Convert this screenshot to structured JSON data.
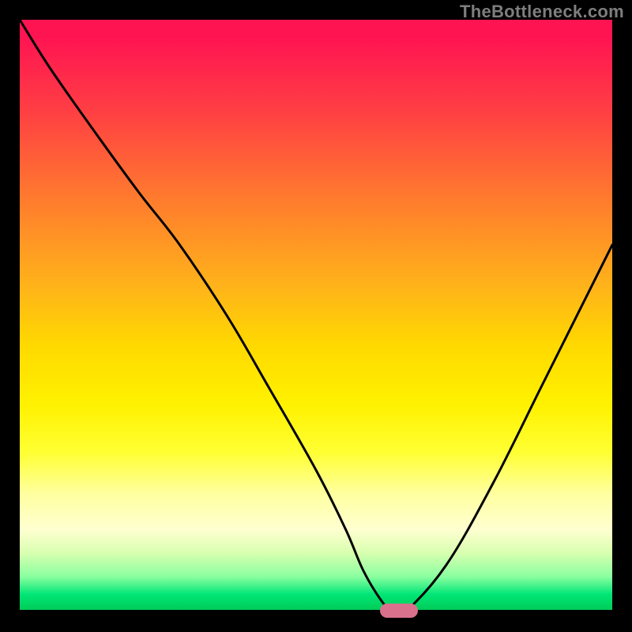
{
  "watermark": "TheBottleneck.com",
  "chart_data": {
    "type": "line",
    "title": "",
    "xlabel": "",
    "ylabel": "",
    "xlim": [
      0,
      100
    ],
    "ylim": [
      0,
      100
    ],
    "x": [
      0,
      5,
      12,
      20,
      27,
      35,
      42,
      50,
      55,
      58,
      61,
      63,
      65,
      72,
      80,
      88,
      95,
      100
    ],
    "values": [
      100,
      92,
      82,
      71,
      62,
      50,
      38,
      24,
      14,
      7,
      2,
      0,
      0,
      8,
      22,
      38,
      52,
      62
    ],
    "minimum_marker": {
      "x": 64,
      "y": 0
    },
    "background_gradient": {
      "top": "#ff1452",
      "mid": "#ffe100",
      "bottom": "#00c853"
    }
  }
}
